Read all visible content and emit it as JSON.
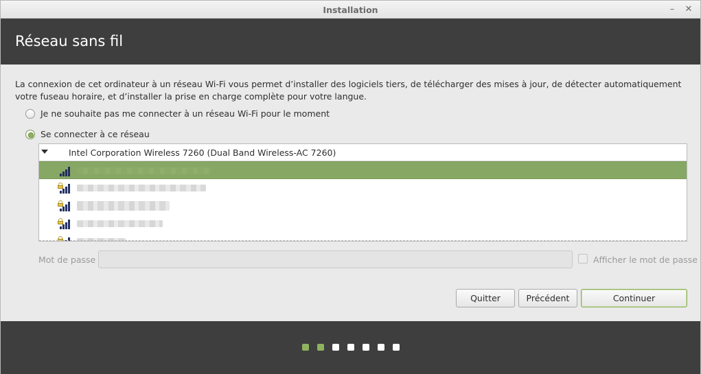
{
  "window": {
    "title": "Installation",
    "minimize_glyph": "–",
    "close_glyph": "✕"
  },
  "header": {
    "title": "Réseau sans fil"
  },
  "description": "La connexion de cet ordinateur à un réseau Wi-Fi vous permet d’installer des logiciels tiers, de télécharger des mises à jour, de détecter automatiquement votre fuseau horaire, et d’installer la prise en charge complète pour votre langue.",
  "options": {
    "no_wifi": {
      "label": "Je ne souhaite pas me connecter à un réseau Wi-Fi pour le moment",
      "checked": false
    },
    "connect": {
      "label": "Se connecter à ce réseau",
      "checked": true
    }
  },
  "networks": {
    "adapter": "Intel Corporation Wireless 7260 (Dual Band Wireless-AC 7260)",
    "items": [
      {
        "icon": "wifi-signal-icon",
        "locked": false,
        "selected": true,
        "name_redacted": true
      },
      {
        "icon": "wifi-secure-icon",
        "locked": true,
        "selected": false,
        "name_redacted": true
      },
      {
        "icon": "wifi-secure-icon",
        "locked": true,
        "selected": false,
        "name_redacted": true
      },
      {
        "icon": "wifi-secure-icon",
        "locked": true,
        "selected": false,
        "name_redacted": true
      },
      {
        "icon": "wifi-secure-icon",
        "locked": true,
        "selected": false,
        "name_redacted": true
      }
    ]
  },
  "password": {
    "label": "Mot de passe :",
    "value": "",
    "show_label": "Afficher le mot de passe",
    "show_checked": false
  },
  "buttons": {
    "quit": "Quitter",
    "previous": "Précédent",
    "continue": "Continuer"
  },
  "progress": {
    "total_steps": 7,
    "completed_steps": 2
  },
  "colors": {
    "accent": "#8fb25e",
    "selection": "#87a765",
    "header_bg": "#3e3e3e"
  }
}
